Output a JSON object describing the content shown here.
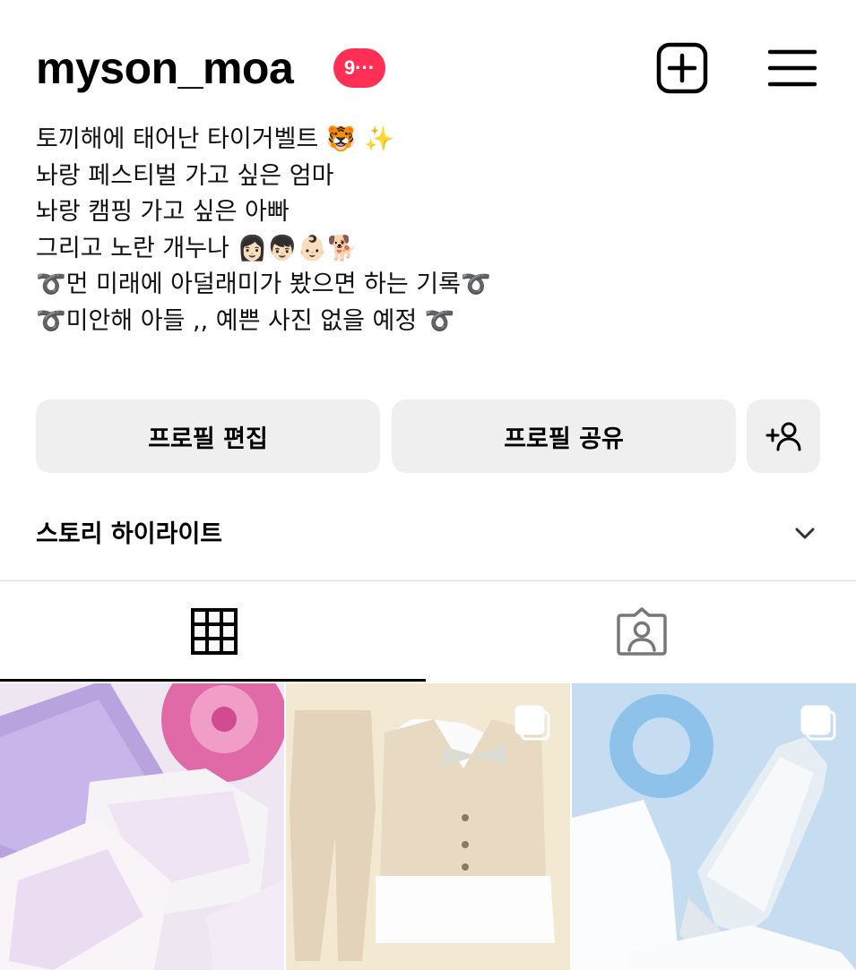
{
  "header": {
    "username": "myson_moa",
    "notification_badge": "9···",
    "new_post_icon": "plus-square-icon",
    "menu_icon": "hamburger-menu-icon"
  },
  "bio": {
    "lines": [
      "토끼해에 태어난 타이거벨트 🐯 ✨",
      "놔랑 페스티벌 가고 싶은 엄마",
      "놔랑 캠핑 가고 싶은 아빠",
      "그리고 노란 개누나 👩🏻👦🏻👶🏻🐕",
      "➰먼 미래에 아덜래미가 봤으면 하는 기록➰",
      "➰미안해 아들 ,, 예쁜 사진 없을 예정 ➰"
    ]
  },
  "actions": {
    "edit_profile": "프로필 편집",
    "share_profile": "프로필 공유",
    "add_person_icon": "add-person-icon"
  },
  "highlights": {
    "label": "스토리 하이라이트",
    "chevron_icon": "chevron-down-icon"
  },
  "tabs": [
    {
      "name": "posts",
      "icon": "grid-icon",
      "active": true
    },
    {
      "name": "tagged",
      "icon": "tagged-user-icon",
      "active": false
    }
  ],
  "posts": [
    {
      "subject": "diapers",
      "multi": false
    },
    {
      "subject": "baby vest outfit",
      "multi": true
    },
    {
      "subject": "baby bottle",
      "multi": true
    }
  ],
  "colors": {
    "badge": "#ff2f55",
    "button_bg": "#efefef",
    "divider": "#dbdbdb"
  }
}
